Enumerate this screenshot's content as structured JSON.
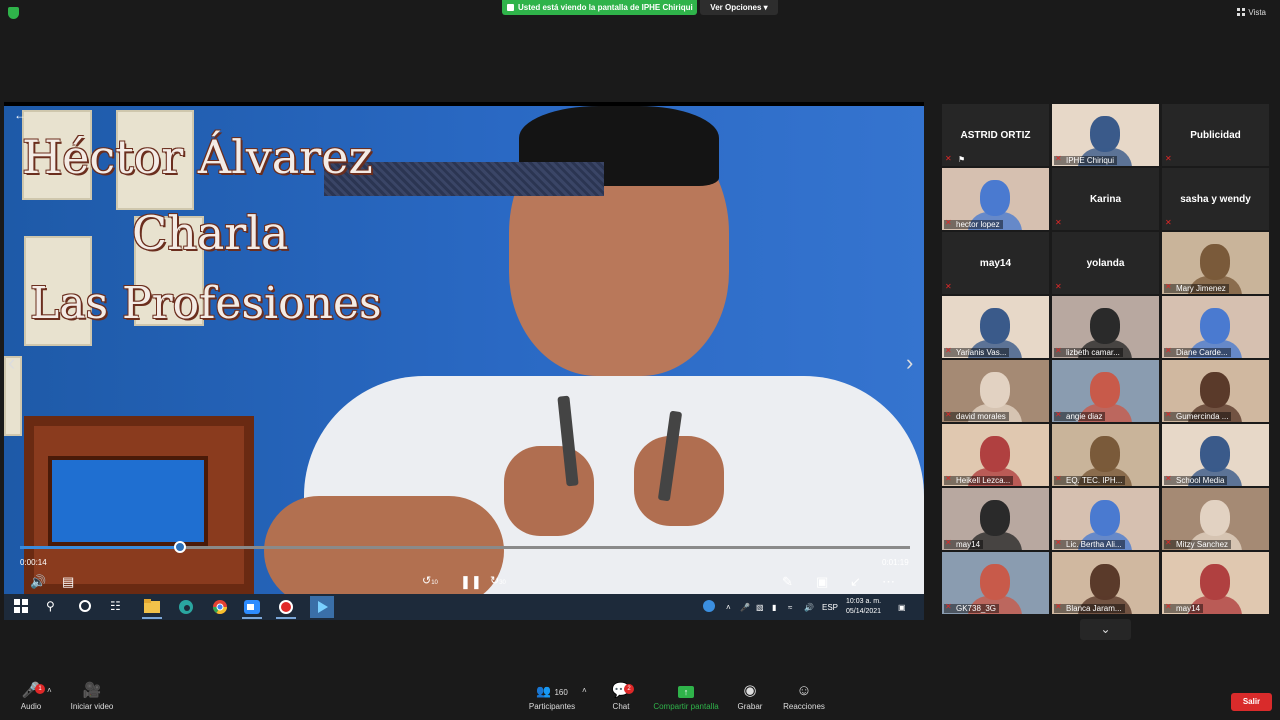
{
  "topbar": {
    "banner_text": "Usted está viendo la pantalla de IPHE Chiriqui",
    "view_options_label": "Ver Opciones",
    "vista_label": "Vista"
  },
  "shared_video": {
    "overlay_line1": "Héctor  Álvarez",
    "overlay_line2": "Charla",
    "overlay_line3": "Las Profesiones",
    "elapsed": "0:00:14",
    "total": "0:01:19",
    "progress_fraction": 0.18,
    "rewind_label": "10",
    "forward_label": "30"
  },
  "taskbar": {
    "language": "ESP",
    "time": "10:03 a. m.",
    "date": "05/14/2021"
  },
  "gallery": {
    "tiles": [
      {
        "name": "ASTRID ORTIZ",
        "video": false
      },
      {
        "name": "IPHE Chiriqui",
        "video": true,
        "active": true
      },
      {
        "name": "Publicidad",
        "video": false
      },
      {
        "name": "hector lopez",
        "video": true
      },
      {
        "name": "Karina",
        "video": false
      },
      {
        "name": "sasha y wendy",
        "video": false
      },
      {
        "name": "may14",
        "video": false
      },
      {
        "name": "yolanda",
        "video": false
      },
      {
        "name": "Mary Jimenez",
        "video": true
      },
      {
        "name": "Yarianis  Vas...",
        "video": true
      },
      {
        "name": "lizbeth camar...",
        "video": true
      },
      {
        "name": "Diane Carde...",
        "video": true
      },
      {
        "name": "david morales",
        "video": true
      },
      {
        "name": "angie diaz",
        "video": true
      },
      {
        "name": "Gumercinda ...",
        "video": true
      },
      {
        "name": "Heikell Lezca...",
        "video": true
      },
      {
        "name": "EQ. TEC. IPH...",
        "video": true
      },
      {
        "name": "School Media",
        "video": true
      },
      {
        "name": "may14",
        "video": true
      },
      {
        "name": "Lic. Bertha Ali...",
        "video": true
      },
      {
        "name": "Mitzy Sanchez",
        "video": true
      },
      {
        "name": "GK738_3G",
        "video": true
      },
      {
        "name": "Blanca Jaram...",
        "video": true
      },
      {
        "name": "may14",
        "video": true
      }
    ]
  },
  "toolbar": {
    "audio_label": "Audio",
    "video_label": "Iniciar video",
    "participants_label": "Participantes",
    "participants_count": "160",
    "chat_label": "Chat",
    "chat_badge": "2",
    "audio_badge": "1",
    "share_label": "Compartir pantalla",
    "record_label": "Grabar",
    "reactions_label": "Reacciones",
    "leave_label": "Salir"
  },
  "colors": {
    "accent_green": "#2fb34a",
    "leave_red": "#d92b2b",
    "active_speaker_yellow": "#e7e35a"
  }
}
